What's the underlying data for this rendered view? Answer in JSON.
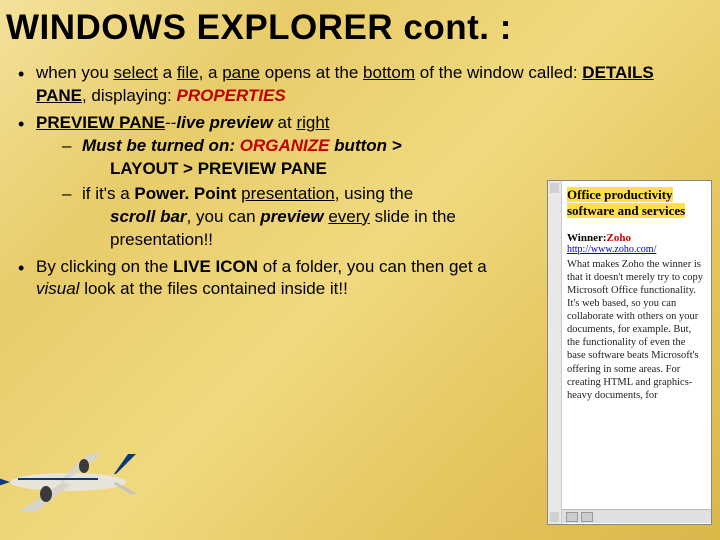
{
  "title": "WINDOWS EXPLORER cont. :",
  "bullets": {
    "b1_pre": "when you ",
    "b1_select": "select",
    "b1_mid1": " a ",
    "b1_file": "file",
    "b1_mid2": ", a ",
    "b1_pane": "pane",
    "b1_mid3": " opens at the ",
    "b1_bottom": "bottom",
    "b1_mid4": " of the window called: ",
    "b1_details": "DETAILS PANE",
    "b1_mid5": ", displaying: ",
    "b1_props": "PROPERTIES",
    "b2_preview": "PREVIEW PANE",
    "b2_dash": "--",
    "b2_live": "live preview",
    "b2_at": " at ",
    "b2_right": "right",
    "b2s1_pre": "Must be turned on: ",
    "b2s1_org": "ORGANIZE",
    "b2s1_btn": " button > ",
    "b2s1_layout": "LAYOUT  >  PREVIEW PANE",
    "b2s2_pre": "if it's a ",
    "b2s2_ppt": "Power. Point",
    "b2s2_mid1": " ",
    "b2s2_pres": "presentation",
    "b2s2_mid2": ", using the ",
    "b2s2_scroll": "scroll bar",
    "b2s2_mid3": ", you can ",
    "b2s2_prev": "preview",
    "b2s2_mid4": " ",
    "b2s2_every": "every",
    "b2s2_mid5": " slide in the presentation!!",
    "b3_pre": "By clicking on the ",
    "b3_live": "LIVE ICON",
    "b3_mid1": " of a folder, you can then get a ",
    "b3_visual": "visual",
    "b3_mid2": " look at the files contained inside it!!"
  },
  "preview": {
    "title": "Office productivity software and services",
    "winner_label": "Winner:",
    "winner_name": "Zoho",
    "link": "http://www.zoho.com/",
    "body": "What makes Zoho the winner is that it doesn't merely try to copy Microsoft Office functionality. It's web based, so you can collaborate with others on your documents, for example. But, the functionality of even the base software beats Microsoft's offering in some areas. For creating HTML and graphics-heavy documents, for"
  }
}
